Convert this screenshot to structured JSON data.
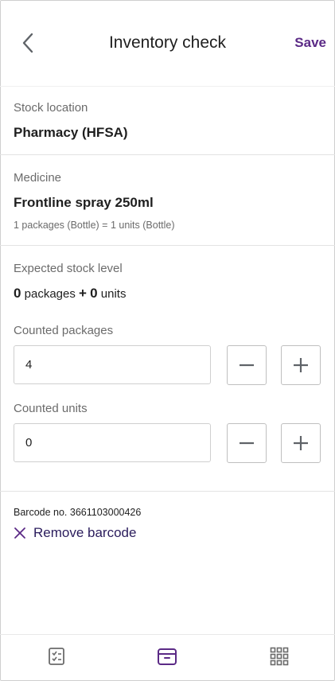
{
  "header": {
    "title": "Inventory check",
    "save_label": "Save"
  },
  "stock_location": {
    "label": "Stock location",
    "value": "Pharmacy (HFSA)"
  },
  "medicine": {
    "label": "Medicine",
    "name": "Frontline spray 250ml",
    "conversion": "1 packages (Bottle) = 1 units (Bottle)"
  },
  "expected": {
    "label": "Expected stock level",
    "packages_value": "0",
    "packages_word": "packages",
    "plus": "+",
    "units_value": "0",
    "units_word": "units"
  },
  "counted_packages": {
    "label": "Counted packages",
    "value": "4"
  },
  "counted_units": {
    "label": "Counted units",
    "value": "0"
  },
  "barcode": {
    "text": "Barcode no. 3661103000426",
    "remove_label": "Remove barcode"
  },
  "colors": {
    "accent": "#5b2a86",
    "text": "#1f1f1f",
    "muted": "#6b6b6b"
  },
  "icons": {
    "back": "chevron-left-icon",
    "remove": "close-icon",
    "nav": [
      "checklist-icon",
      "inventory-box-icon",
      "grid-icon"
    ],
    "nav_active_index": 1
  }
}
